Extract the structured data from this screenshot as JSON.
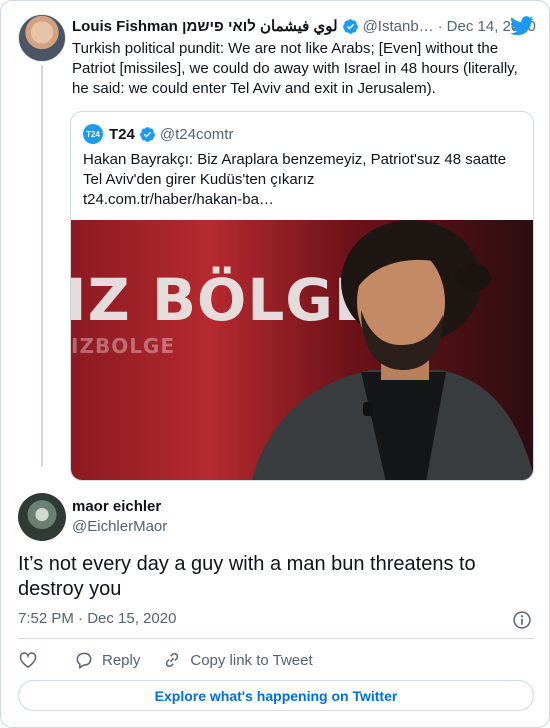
{
  "parent": {
    "author_name": "Louis Fishman لوي فيشمان לואי פישמן",
    "handle": "@Istanb…",
    "date": "Dec 14, 2020",
    "text": "Turkish political pundit: We are not like Arabs; [Even] without the Patriot [missiles], we could do away with Israel in 48 hours (literally, he said: we could enter Tel Aviv and exit in Jerusalem).",
    "separator": "·"
  },
  "quoted": {
    "logo_text": "T24",
    "name": "T24",
    "handle": "@t24comtr",
    "text": "Hakan Bayrakçı: Biz Araplara benzemeyiz, Patriot'suz 48 saatte Tel Aviv'den girer Kudüs'ten çıkarız",
    "link": "t24.com.tr/haber/hakan-ba…",
    "media_overlay_text": "IZ BÖLGE",
    "media_overlay_sub": "IZBOLGE"
  },
  "reply": {
    "name": "maor eichler",
    "handle": "@EichlerMaor",
    "text": "It’s not every day a guy with a man bun threatens to destroy you",
    "timestamp": "7:52 PM · Dec 15, 2020"
  },
  "actions": {
    "reply_label": "Reply",
    "copy_label": "Copy link to Tweet"
  },
  "footer": {
    "explore_label": "Explore what's happening on Twitter"
  },
  "colors": {
    "accent": "#1d9bf0",
    "link": "#006fd6",
    "secondary_text": "#536471",
    "border": "#cfd9de"
  }
}
